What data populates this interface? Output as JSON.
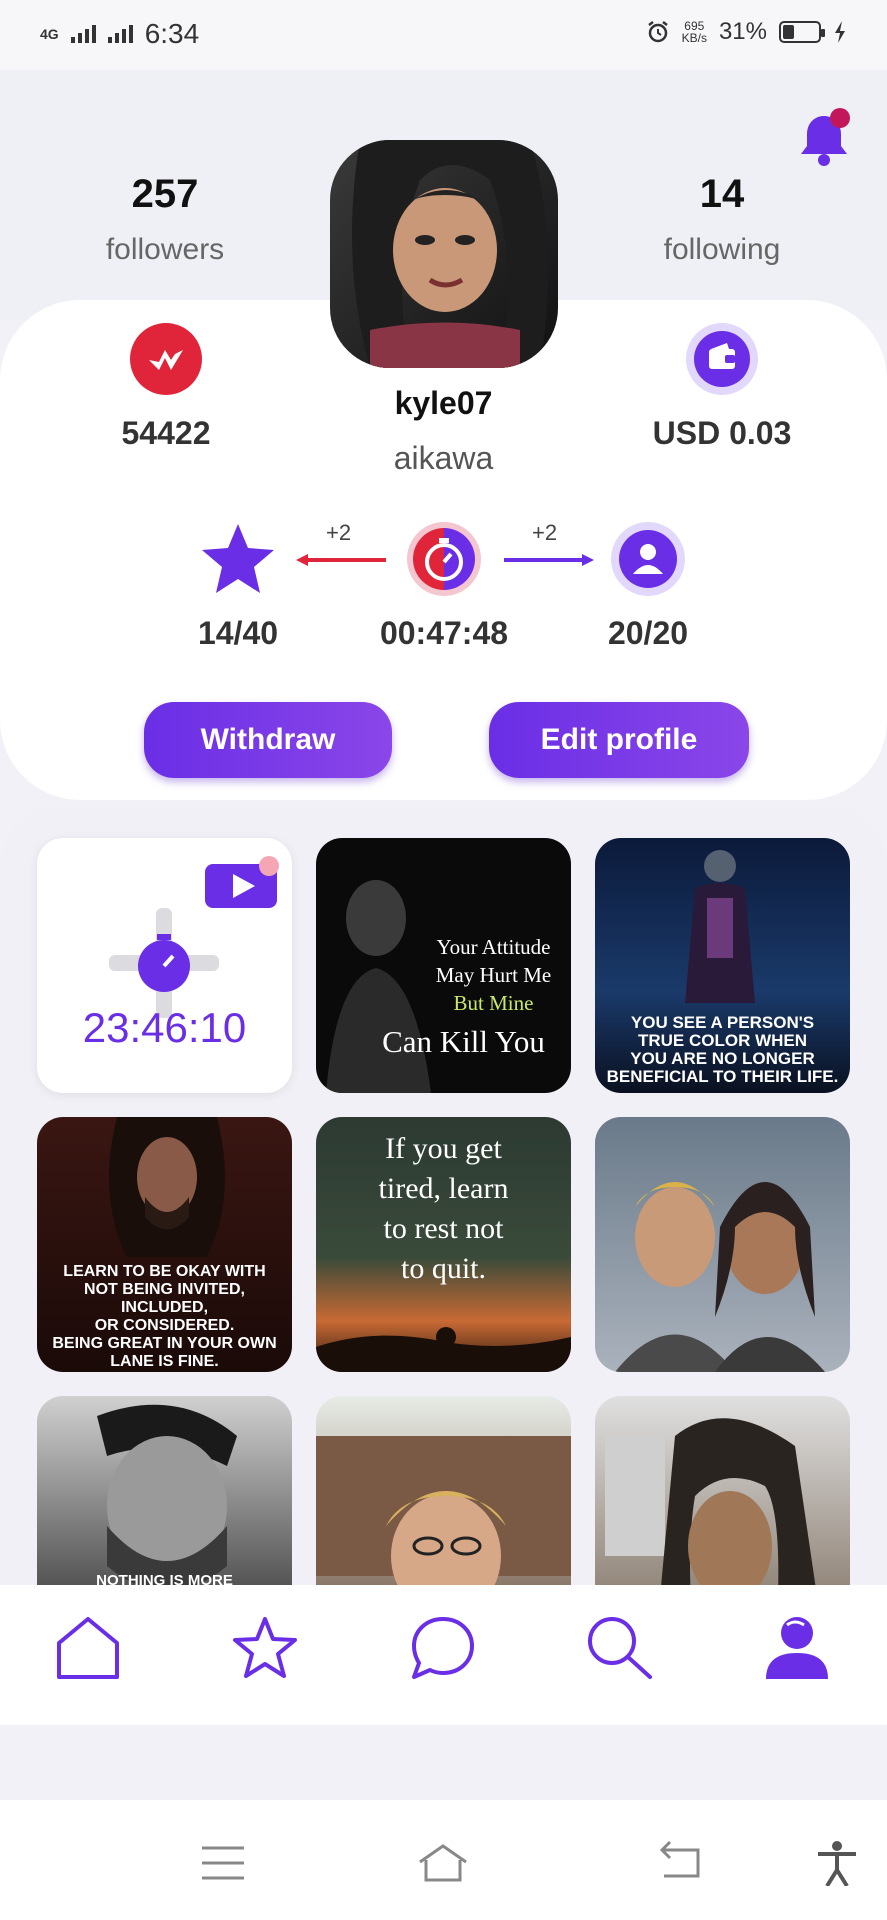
{
  "status_bar": {
    "network": "4G",
    "time": "6:34",
    "speed_value": "695",
    "speed_unit": "KB/s",
    "battery": "31%"
  },
  "profile": {
    "followers_count": "257",
    "followers_label": "followers",
    "following_count": "14",
    "following_label": "following",
    "username": "kyle07",
    "display_name": "aikawa",
    "coins": "54422",
    "wallet": "USD 0.03"
  },
  "progress": {
    "stars": "14/40",
    "stars_bonus": "+2",
    "timer": "00:47:48",
    "users_bonus": "+2",
    "users": "20/20"
  },
  "buttons": {
    "withdraw": "Withdraw",
    "edit_profile": "Edit profile"
  },
  "grid": {
    "timer_value": "23:46:10",
    "tile2_lines": [
      "Your Attitude",
      "May Hurt Me",
      "But Mine",
      "Can Kill You"
    ],
    "tile3_lines": [
      "YOU SEE A PERSON'S",
      "TRUE COLOR WHEN",
      "YOU ARE NO LONGER",
      "BENEFICIAL TO THEIR LIFE."
    ],
    "tile4_lines": [
      "LEARN TO BE OKAY WITH",
      "NOT BEING INVITED, INCLUDED,",
      "OR CONSIDERED.",
      "BEING GREAT IN YOUR OWN",
      "LANE IS FINE."
    ],
    "tile5_lines": [
      "If you get",
      "tired, learn",
      "to rest not",
      "to quit."
    ],
    "tile7_caption": "NOTHING IS MORE"
  },
  "colors": {
    "accent": "#6a2ee6",
    "red": "#e0243a",
    "notification_dot": "#c2185b"
  },
  "icons": {
    "nav": [
      "home-icon",
      "star-icon",
      "chat-icon",
      "search-icon",
      "profile-icon"
    ],
    "system": [
      "menu-icon",
      "home-outline-icon",
      "back-icon",
      "accessibility-icon"
    ]
  }
}
